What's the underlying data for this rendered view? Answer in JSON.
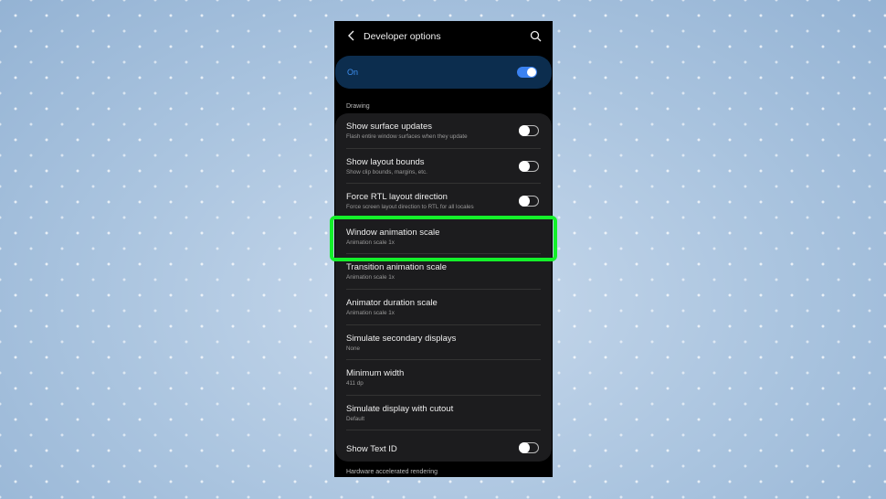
{
  "header": {
    "title": "Developer options",
    "back_icon": "chevron-left-icon",
    "search_icon": "search-icon"
  },
  "master": {
    "label": "On",
    "enabled": true,
    "accent": "#3b82f0"
  },
  "section_drawing": "Drawing",
  "items": [
    {
      "title": "Show surface updates",
      "subtitle": "Flash entire window surfaces when they update",
      "toggle": false
    },
    {
      "title": "Show layout bounds",
      "subtitle": "Show clip bounds, margins, etc.",
      "toggle": false
    },
    {
      "title": "Force RTL layout direction",
      "subtitle": "Force screen layout direction to RTL for all locales",
      "toggle": false
    },
    {
      "title": "Window animation scale",
      "subtitle": "Animation scale 1x",
      "highlighted": true
    },
    {
      "title": "Transition animation scale",
      "subtitle": "Animation scale 1x"
    },
    {
      "title": "Animator duration scale",
      "subtitle": "Animation scale 1x"
    },
    {
      "title": "Simulate secondary displays",
      "subtitle": "None"
    },
    {
      "title": "Minimum width",
      "subtitle": "411 dp"
    },
    {
      "title": "Simulate display with cutout",
      "subtitle": "Default"
    },
    {
      "title": "Show Text ID",
      "toggle": false
    }
  ],
  "section_hw": "Hardware accelerated rendering",
  "highlight_color": "#14f02a"
}
